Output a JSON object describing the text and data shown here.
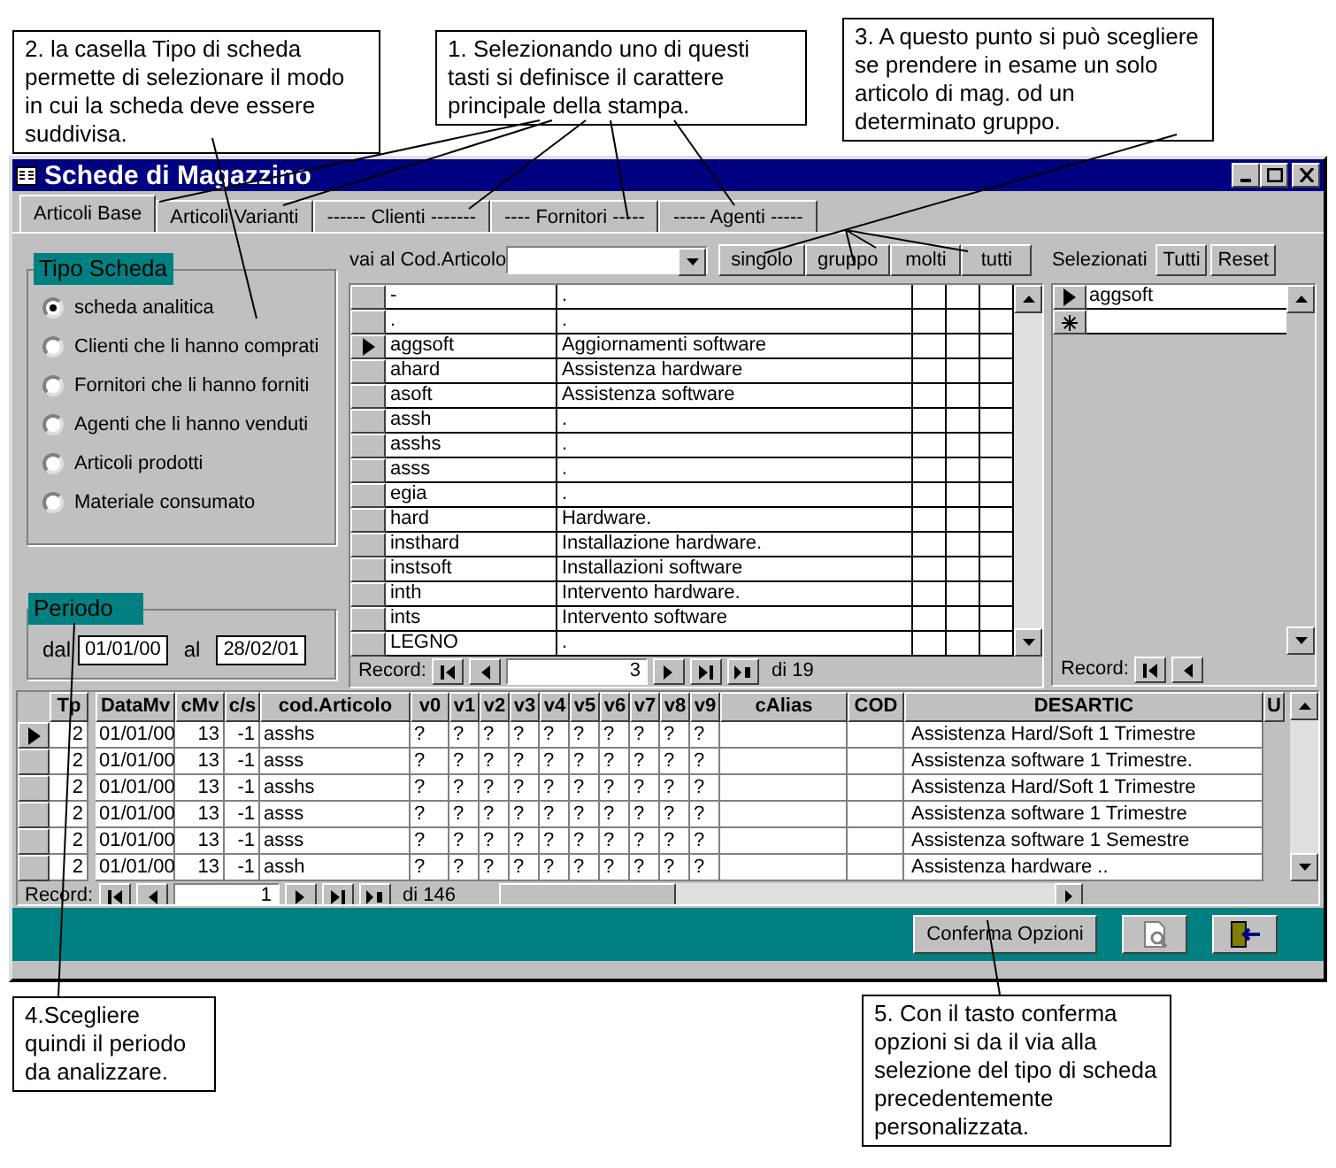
{
  "callouts": [
    {
      "text": "2. la casella Tipo di scheda permette di selezionare il modo in cui la scheda deve essere suddivisa."
    },
    {
      "text": "1. Selezionando uno di questi tasti si definisce il carattere principale della stampa."
    },
    {
      "text": "3. A questo punto si può scegliere se prendere in esame un solo articolo di mag. od un determinato gruppo."
    },
    {
      "text": "4.Scegliere quindi il periodo da analizzare."
    },
    {
      "text": "5. Con il tasto conferma opzioni si da il via alla selezione del tipo di scheda precedentemente personalizzata."
    }
  ],
  "window": {
    "title": "Schede di Magazzino"
  },
  "tabs": [
    {
      "label": "Articoli Base",
      "selected": true
    },
    {
      "label": "Articoli Varianti",
      "selected": false
    },
    {
      "label": "------ Clienti -------",
      "selected": false
    },
    {
      "label": "---- Fornitori -----",
      "selected": false
    },
    {
      "label": "----- Agenti -----",
      "selected": false
    }
  ],
  "tipo_scheda": {
    "title": "Tipo Scheda",
    "options": [
      {
        "label": "scheda analitica",
        "selected": true
      },
      {
        "label": "Clienti che li hanno comprati",
        "selected": false
      },
      {
        "label": "Fornitori che li hanno forniti",
        "selected": false
      },
      {
        "label": "Agenti che li hanno venduti",
        "selected": false
      },
      {
        "label": "Articoli prodotti",
        "selected": false
      },
      {
        "label": "Materiale consumato",
        "selected": false
      }
    ]
  },
  "periodo": {
    "title": "Periodo",
    "from_label": "dal",
    "from": "01/01/00",
    "to_label": "al",
    "to": "28/02/01"
  },
  "lookup": {
    "label": "vai al Cod.Articolo",
    "buttons": [
      "singolo",
      "gruppo",
      "molti",
      "tutti"
    ]
  },
  "articles": {
    "rows": [
      {
        "code": "-",
        "description": ".",
        "current": false
      },
      {
        "code": ".",
        "description": ".",
        "current": false
      },
      {
        "code": "aggsoft",
        "description": "Aggiornamenti software",
        "current": true
      },
      {
        "code": "ahard",
        "description": "Assistenza hardware",
        "current": false
      },
      {
        "code": "asoft",
        "description": "Assistenza software",
        "current": false
      },
      {
        "code": "assh",
        "description": ".",
        "current": false
      },
      {
        "code": "asshs",
        "description": ".",
        "current": false
      },
      {
        "code": "asss",
        "description": ".",
        "current": false
      },
      {
        "code": "egia",
        "description": ".",
        "current": false
      },
      {
        "code": "hard",
        "description": "Hardware.",
        "current": false
      },
      {
        "code": "insthard",
        "description": "Installazione hardware.",
        "current": false
      },
      {
        "code": "instsoft",
        "description": "Installazioni software",
        "current": false
      },
      {
        "code": "inth",
        "description": "Intervento hardware.",
        "current": false
      },
      {
        "code": "ints",
        "description": "Intervento software",
        "current": false
      },
      {
        "code": "LEGNO",
        "description": ".",
        "current": false
      }
    ],
    "nav": {
      "label": "Record:",
      "record": "3",
      "total": "di 19"
    }
  },
  "selected_panel": {
    "label": "Selezionati",
    "buttons": [
      "Tutti",
      "Reset"
    ],
    "rows": [
      {
        "code": "aggsoft",
        "current": true
      }
    ],
    "nav": {
      "label": "Record:"
    }
  },
  "movements": {
    "columns": [
      "Tp",
      "DataMv",
      "cMv",
      "c/s",
      "cod.Articolo",
      "v0",
      "v1",
      "v2",
      "v3",
      "v4",
      "v5",
      "v6",
      "v7",
      "v8",
      "v9",
      "cAlias",
      "COD",
      "DESARTIC",
      "U"
    ],
    "rows": [
      {
        "tp": "2",
        "date": "01/01/00",
        "cmv": "13",
        "cs": "-1",
        "code": "asshs",
        "v": [
          "?",
          "?",
          "?",
          "?",
          "?",
          "?",
          "?",
          "?",
          "?",
          "?"
        ],
        "desc": "Assistenza Hard/Soft 1 Trimestre",
        "current": true
      },
      {
        "tp": "2",
        "date": "01/01/00",
        "cmv": "13",
        "cs": "-1",
        "code": "asss",
        "v": [
          "?",
          "?",
          "?",
          "?",
          "?",
          "?",
          "?",
          "?",
          "?",
          "?"
        ],
        "desc": "Assistenza software 1 Trimestre.",
        "current": false
      },
      {
        "tp": "2",
        "date": "01/01/00",
        "cmv": "13",
        "cs": "-1",
        "code": "asshs",
        "v": [
          "?",
          "?",
          "?",
          "?",
          "?",
          "?",
          "?",
          "?",
          "?",
          "?"
        ],
        "desc": "Assistenza Hard/Soft 1 Trimestre",
        "current": false
      },
      {
        "tp": "2",
        "date": "01/01/00",
        "cmv": "13",
        "cs": "-1",
        "code": "asss",
        "v": [
          "?",
          "?",
          "?",
          "?",
          "?",
          "?",
          "?",
          "?",
          "?",
          "?"
        ],
        "desc": "Assistenza software 1 Trimestre",
        "current": false
      },
      {
        "tp": "2",
        "date": "01/01/00",
        "cmv": "13",
        "cs": "-1",
        "code": "asss",
        "v": [
          "?",
          "?",
          "?",
          "?",
          "?",
          "?",
          "?",
          "?",
          "?",
          "?"
        ],
        "desc": "Assistenza software 1 Semestre",
        "current": false
      },
      {
        "tp": "2",
        "date": "01/01/00",
        "cmv": "13",
        "cs": "-1",
        "code": "assh",
        "v": [
          "?",
          "?",
          "?",
          "?",
          "?",
          "?",
          "?",
          "?",
          "?",
          "?"
        ],
        "desc": "Assistenza hardware ..",
        "current": false
      }
    ],
    "nav": {
      "label": "Record:",
      "record": "1",
      "total": "di 146"
    }
  },
  "footer": {
    "confirm": "Conferma Opzioni"
  }
}
